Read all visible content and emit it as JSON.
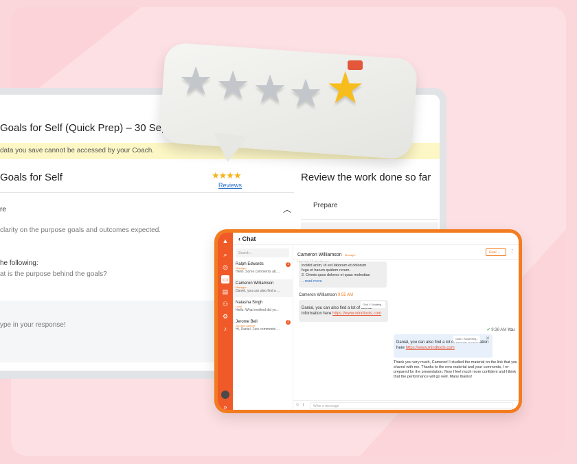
{
  "goals_window": {
    "title": "Goals for Self (Quick Prep) – 30 Sep | 11:47 AM",
    "notice": "data you save cannot be accessed by your Coach.",
    "section_title": "Goals for Self",
    "rating_stars": "★★★★",
    "reviews_link": "Reviews",
    "prepare_heading": "re",
    "clarity_text": "clarity on the purpose goals and outcomes expected.",
    "following_text": "he following:",
    "purpose_question": "at is the purpose behind the goals?",
    "response_placeholder": "ype in your response!",
    "review_title": "Review the work done so far",
    "review_item_prepare": "Prepare"
  },
  "rating_bubble": {
    "stars_total": 5,
    "stars_highlighted": 1
  },
  "chat": {
    "header_title": "Chat",
    "back_icon": "‹",
    "search_placeholder": "Search...",
    "contacts": [
      {
        "name": "Ralph Edwards",
        "role": "Manager",
        "snippet": "Hello. Some comments ab....",
        "badge": "1"
      },
      {
        "name": "Cameron Williamson",
        "role": "Manager",
        "snippet": "Daniel, you can also find a ...",
        "badge": ""
      },
      {
        "name": "Natasha Singh",
        "role": "Lead",
        "snippet": "Hello. What method did yo...",
        "badge": ""
      },
      {
        "name": "Jerome Bell",
        "role": "Journey partner",
        "snippet": "Hi, Daniel. Few comments ...",
        "badge": "3"
      }
    ],
    "conversation": {
      "name": "Cameron Williamson",
      "role": "Manager",
      "subtitle": "Last seen 15 minutes ago",
      "goal_button": "Goal",
      "msg1_line1": "incidid anim, id est laborum et dolorum",
      "msg1_line2": "fuga et harum quidem rerum.",
      "msg1_line3": "2. Omnis quos dolores et quas molestias",
      "msg1_readmore": "...read more",
      "sender2_name": "Cameron Williamson",
      "sender2_time": "9:55 AM",
      "msg2_quote_tag": "Goal 1: Sculpting...",
      "msg2_text": "Danial, you can also find a lot of useful information here",
      "msg2_link": "https://www.mindtools.com",
      "you_time": "9:38 AM",
      "you_label": "You",
      "reply_quote_tag": "Goal 1: Scope leng...",
      "reply_quote_text": "Danial, you can also find a lot of useful information here",
      "reply_quote_link": "https://www.mindtools.com",
      "reply_text": "Thank you very much, Cameron! I studied the material on the link that you shared with me. Thanks to the new material and your comments, I re-prepared for the presentation. Now I feel much more confident and I think that the performance will go well. Many thanks!",
      "input_placeholder": "Write a message"
    }
  },
  "colors": {
    "accent_orange": "#f27c1f",
    "rail_orange": "#f05a28",
    "star_gold": "#f7bd1d",
    "background_pink": "#fbd6da"
  }
}
